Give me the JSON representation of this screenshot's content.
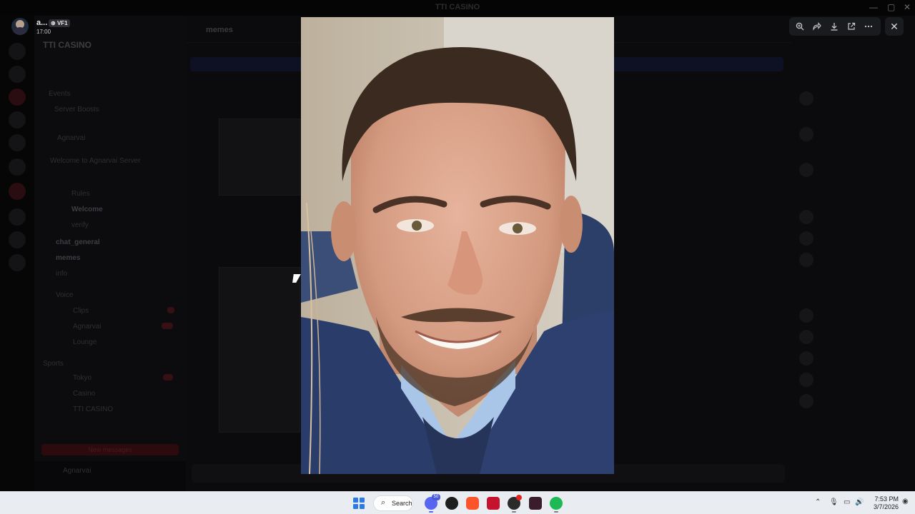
{
  "window": {
    "title": "TTI CASINO"
  },
  "sidebar": {
    "server_name": "TTI CASINO",
    "items": [
      "Events",
      "Server Boosts",
      "Agnarvai",
      "Welcome to Agnarvai Server",
      "Rules",
      "Welcome",
      "verify",
      "chat_general",
      "memes",
      "info",
      "Voice",
      "Clips",
      "Agnarvai",
      "Lounge",
      "Sports",
      "Tokyo",
      "Casino",
      "TTI CASINO"
    ],
    "bottom_button": "New messages",
    "user_name": "Agnarvai"
  },
  "main": {
    "channel_name": "memes"
  },
  "viewer": {
    "uploader_name": "a...",
    "uploader_tag": "VF1",
    "timestamp": "17:00",
    "tools": [
      "zoom-in-icon",
      "forward-icon",
      "download-icon",
      "open-external-icon",
      "more-icon"
    ],
    "close_icon": "close-icon"
  },
  "taskbar": {
    "search_label": "Search",
    "apps": [
      "discord-icon",
      "g-icon",
      "brave-icon",
      "acrobat-icon",
      "app-icon",
      "app2-icon",
      "spotify-icon"
    ],
    "discord_badge": "50",
    "time": "7:53 PM",
    "date": "3/7/2026"
  },
  "colors": {
    "accent": "#2c7be5",
    "discord": "#5865f2",
    "spotify": "#1db954"
  }
}
